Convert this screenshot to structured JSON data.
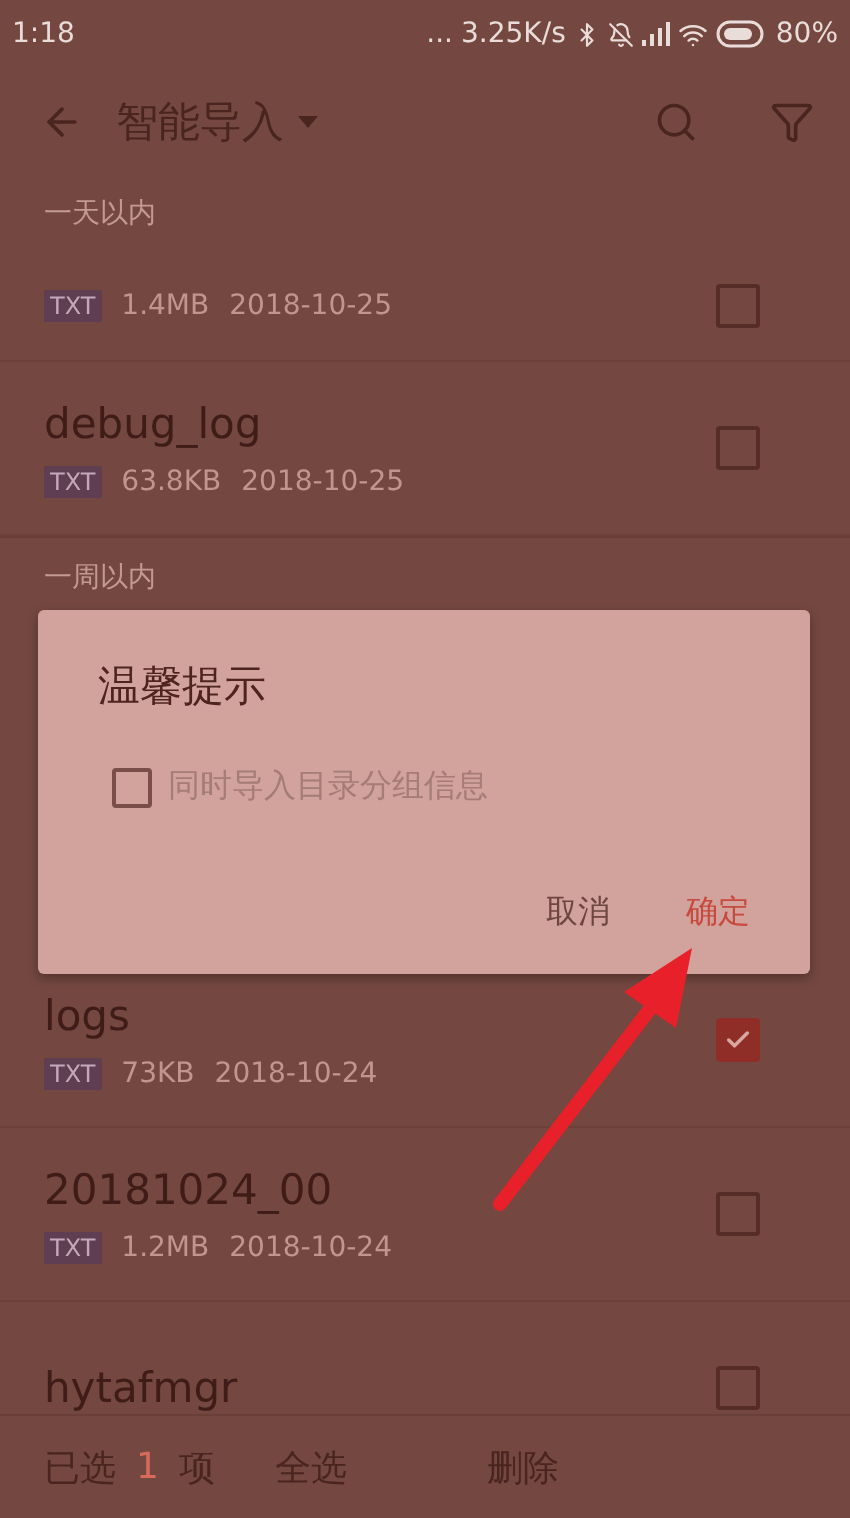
{
  "status_bar": {
    "time": "1:18",
    "dots": "...",
    "speed": "3.25K/s",
    "battery": "80%"
  },
  "app_bar": {
    "title": "智能导入"
  },
  "sections": [
    {
      "header": "一天以内",
      "items": [
        {
          "badge": "TXT",
          "size": "1.4MB",
          "date": "2018-10-25",
          "checked": false
        },
        {
          "name": "debug_log",
          "badge": "TXT",
          "size": "63.8KB",
          "date": "2018-10-25",
          "checked": false
        }
      ]
    },
    {
      "header": "一周以内",
      "items": [
        {
          "name": "logs",
          "badge": "TXT",
          "size": "73KB",
          "date": "2018-10-24",
          "checked": true
        },
        {
          "name": "20181024_00",
          "badge": "TXT",
          "size": "1.2MB",
          "date": "2018-10-24",
          "checked": false
        },
        {
          "name": "hytafmgr",
          "checked": false
        }
      ]
    }
  ],
  "dialog": {
    "title": "温馨提示",
    "option": {
      "label": "同时导入目录分组信息",
      "checked": false
    },
    "buttons": [
      {
        "label": "取消",
        "kind": "cancel"
      },
      {
        "label": "确定",
        "kind": "confirm"
      }
    ]
  },
  "bottom_bar": {
    "selected_prefix": "已选",
    "count": "1",
    "selected_suffix": "项",
    "select_all": "全选",
    "delete": "删除"
  }
}
